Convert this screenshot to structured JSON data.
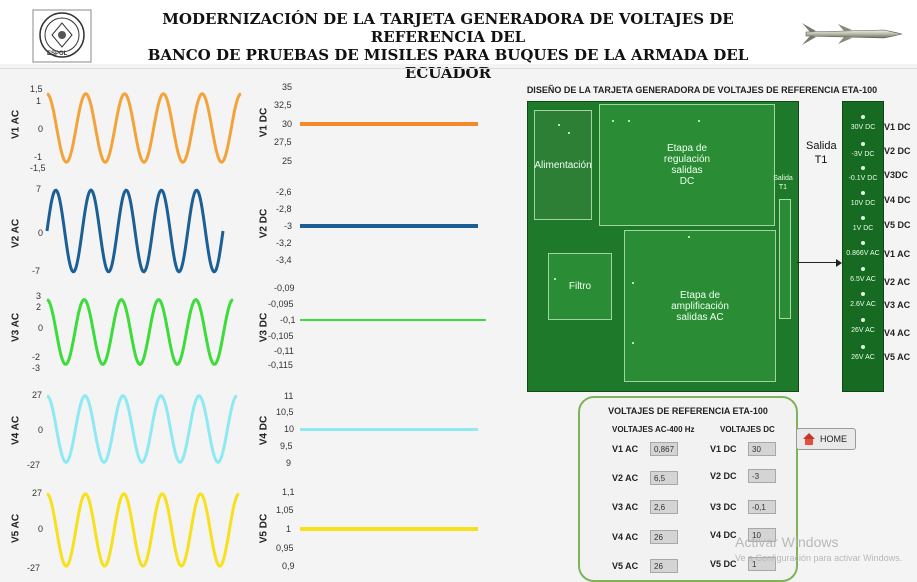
{
  "header": {
    "title_line1": "MODERNIZACIÓN DE LA TARJETA GENERADORA DE VOLTAJES DE REFERENCIA DEL",
    "title_line2": "BANCO DE PRUEBAS DE MISILES PARA BUQUES DE LA ARMADA DEL ECUADOR",
    "logo_text": "ESPOL"
  },
  "ac_plots": [
    {
      "label": "V1 AC",
      "ticks": [
        "1,5",
        "1",
        "0",
        "-1",
        "-1,5"
      ],
      "color": "#f3a33c",
      "amplitude_frac": 0.9
    },
    {
      "label": "V2 AC",
      "ticks": [
        "7",
        "0",
        "-7"
      ],
      "color": "#1c5f95",
      "amplitude_frac": 0.95
    },
    {
      "label": "V3 AC",
      "ticks": [
        "3",
        "2",
        "0",
        "-2",
        "-3"
      ],
      "color": "#3ddc3a",
      "amplitude_frac": 0.9
    },
    {
      "label": "V4 AC",
      "ticks": [
        "27",
        "0",
        "-27"
      ],
      "color": "#8ee9f3",
      "amplitude_frac": 0.95
    },
    {
      "label": "V5 AC",
      "ticks": [
        "27",
        "0",
        "-27"
      ],
      "color": "#f7e01c",
      "amplitude_frac": 0.95
    }
  ],
  "dc_plots": [
    {
      "label": "V1 DC",
      "ticks": [
        "35",
        "32,5",
        "30",
        "27,5",
        "25"
      ],
      "color": "#f28a2b",
      "value_index": 2
    },
    {
      "label": "V2 DC",
      "ticks": [
        "-2,6",
        "-2,8",
        "-3",
        "-3,2",
        "-3,4"
      ],
      "color": "#1c5f95",
      "value_index": 2
    },
    {
      "label": "V3 DC",
      "ticks": [
        "-0,09",
        "-0,095",
        "-0,1",
        "-0,105",
        "-0,11",
        "-0,115"
      ],
      "color": "#3ddc3a",
      "value_index": 2
    },
    {
      "label": "V4 DC",
      "ticks": [
        "11",
        "10,5",
        "10",
        "9,5",
        "9"
      ],
      "color": "#8ee9f3",
      "value_index": 2
    },
    {
      "label": "V5 DC",
      "ticks": [
        "1,1",
        "1,05",
        "1",
        "0,95",
        "0,9"
      ],
      "color": "#f7e01c",
      "value_index": 2
    }
  ],
  "board": {
    "title": "DISEÑO DE LA TARJETA GENERADORA DE VOLTAJES DE REFERENCIA ETA-100",
    "blocks": {
      "alimentacion": "Alimentación",
      "regulacion_1": "Etapa de",
      "regulacion_2": "regulación",
      "regulacion_3": "salidas",
      "regulacion_4": "DC",
      "filtro": "Filtro",
      "amplificacion_1": "Etapa de",
      "amplificacion_2": "amplificación",
      "amplificacion_3": "salidas AC",
      "salida_small_1": "Salida",
      "salida_small_2": "T1"
    },
    "salida_1": "Salida",
    "salida_2": "T1",
    "pins": [
      "30V DC",
      "-3V DC",
      "-0.1V DC",
      "10V DC",
      "1V DC",
      "0.866V AC",
      "6.5V AC",
      "2.6V AC",
      "26V AC",
      "26V AC"
    ],
    "outputs": [
      "V1 DC",
      "V2 DC",
      "V3DC",
      "V4 DC",
      "V5 DC",
      "V1 AC",
      "V2 AC",
      "V3 AC",
      "V4 AC",
      "V5 AC"
    ]
  },
  "reference_panel": {
    "title": "VOLTAJES DE REFERENCIA ETA-100",
    "ac_header": "VOLTAJES AC-400 Hz",
    "dc_header": "VOLTAJES DC",
    "ac_rows": [
      {
        "label": "V1 AC",
        "value": "0,867"
      },
      {
        "label": "V2 AC",
        "value": "6,5"
      },
      {
        "label": "V3 AC",
        "value": "2,6"
      },
      {
        "label": "V4 AC",
        "value": "26"
      },
      {
        "label": "V5 AC",
        "value": "26"
      }
    ],
    "dc_rows": [
      {
        "label": "V1 DC",
        "value": "30"
      },
      {
        "label": "V2 DC",
        "value": "-3"
      },
      {
        "label": "V3 DC",
        "value": "-0,1"
      },
      {
        "label": "V4 DC",
        "value": "10"
      },
      {
        "label": "V5 DC",
        "value": "1"
      }
    ]
  },
  "home_button": {
    "label": "HOME",
    "icon": "home-icon"
  },
  "watermark": {
    "line1": "Activar Windows",
    "line2": "Ve a Configuración para activar Windows."
  }
}
